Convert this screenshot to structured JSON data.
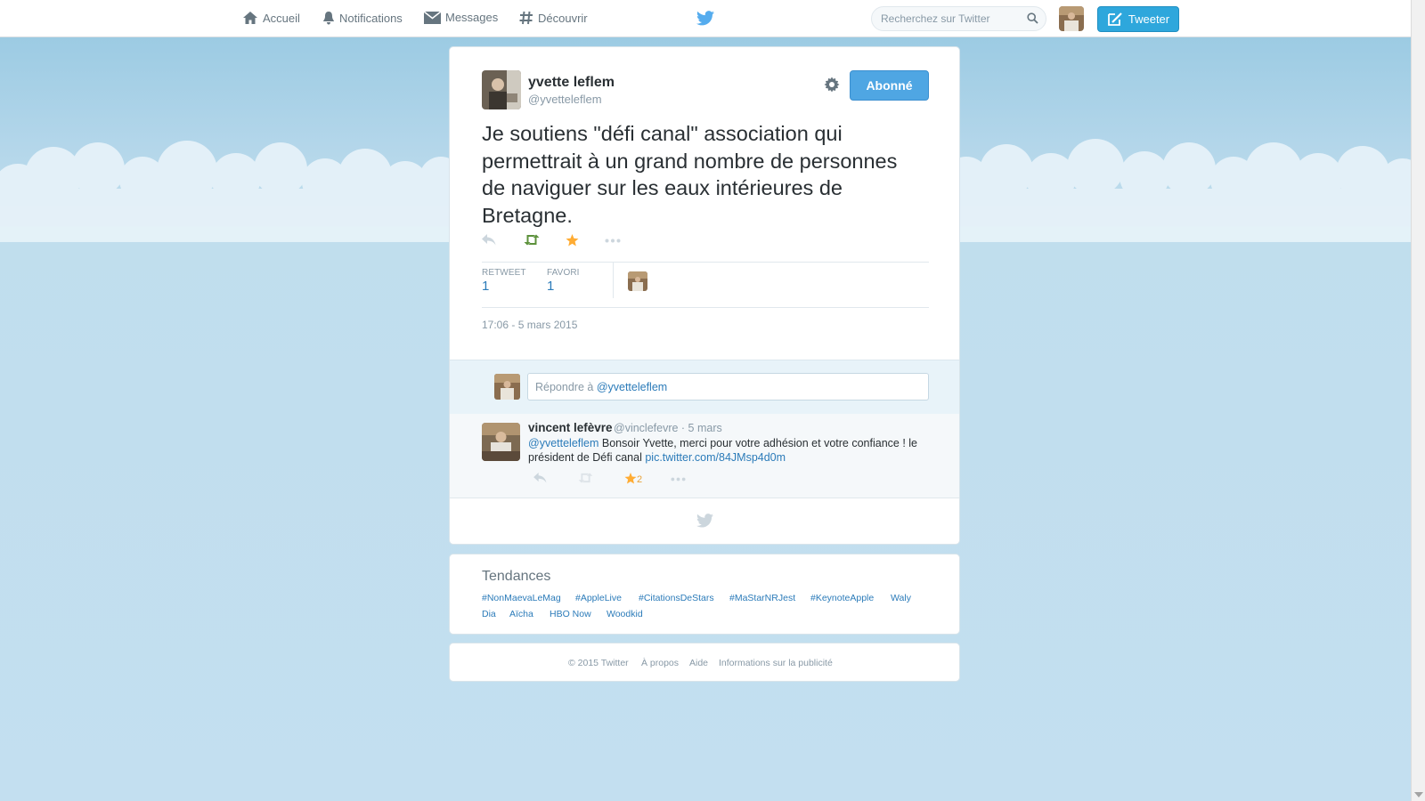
{
  "nav": {
    "home": "Accueil",
    "notifications": "Notifications",
    "messages": "Messages",
    "discover": "Découvrir"
  },
  "search": {
    "placeholder": "Recherchez sur Twitter"
  },
  "compose": {
    "label": "Tweeter"
  },
  "tweet": {
    "author_name": "yvette leflem",
    "author_handle": "@yvetteleflem",
    "follow_label": "Abonné",
    "text": "Je soutiens \"défi canal\" association qui permettrait à un grand nombre de personnes de naviguer sur les eaux intérieures de Bretagne.",
    "retweet_label": "RETWEET",
    "retweet_count": "1",
    "favorite_label": "FAVORI",
    "favorite_count": "1",
    "timestamp": "17:06 - 5 mars 2015"
  },
  "reply_box": {
    "prefix": "Répondre à ",
    "mention": "@yvetteleflem"
  },
  "reply": {
    "author_name": "vincent lefèvre",
    "author_handle": "@vinclefevre",
    "date": "· 5 mars",
    "mention": "@yvetteleflem",
    "text": " Bonsoir Yvette, merci pour votre adhésion et votre confiance ! le président de Défi canal ",
    "link": "pic.twitter.com/84JMsp4d0m",
    "favorite_count": "2"
  },
  "trends": {
    "title": "Tendances",
    "items": [
      "#NonMaevaLeMag",
      "#AppleLive",
      "#CitationsDeStars",
      "#MaStarNRJest",
      "#KeynoteApple",
      "Waly",
      "Dia",
      "Aïcha",
      "HBO Now",
      "Woodkid"
    ]
  },
  "footer": {
    "links": [
      "© 2015 Twitter",
      "À propos",
      "Aide",
      "Informations sur la publicité"
    ]
  },
  "colors": {
    "accent": "#2ea7dc",
    "follow": "#4fa6e3",
    "retweet_active": "#5c913b",
    "favorite_active": "#ffac33",
    "link": "#2b7bb9"
  }
}
